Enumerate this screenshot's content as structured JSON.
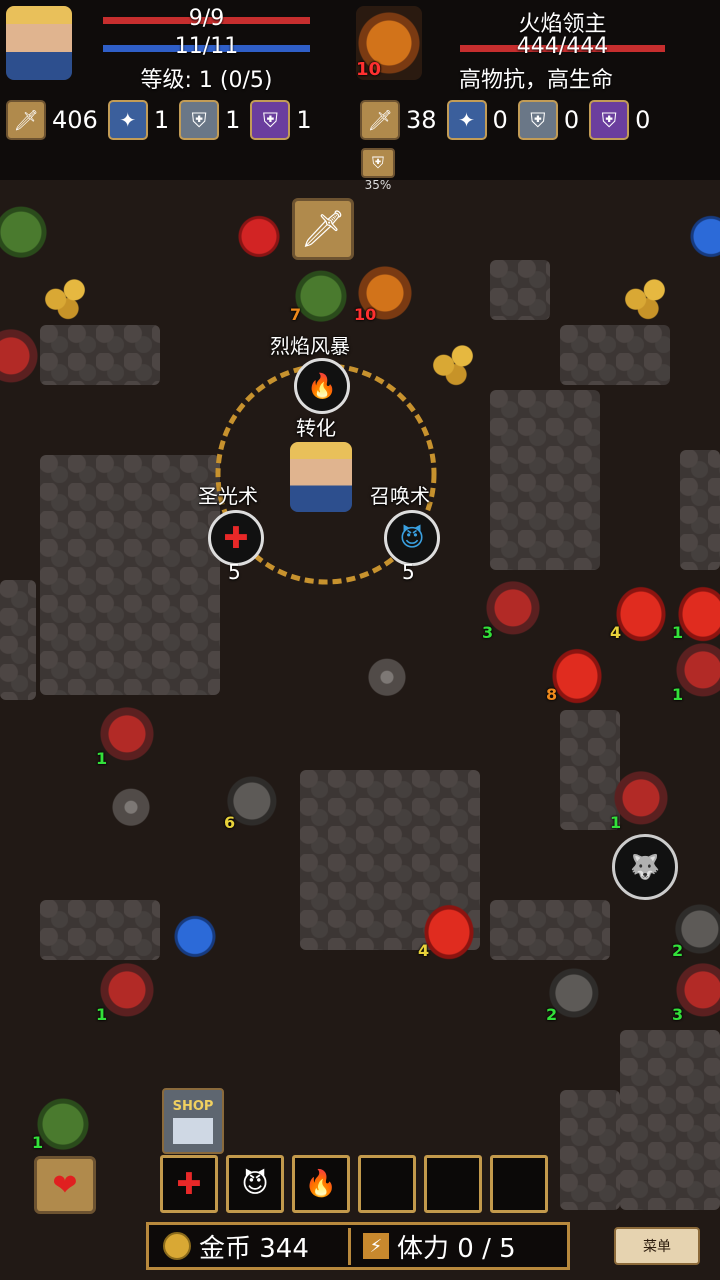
{
  "hero": {
    "hp": "9/9",
    "mp": "11/11",
    "level": "等级: 1 (0/5)",
    "stats": {
      "attack": "406",
      "magic": "1",
      "defense": "1",
      "magic_defense": "1"
    }
  },
  "target": {
    "name": "火焰领主",
    "hp": "444/444",
    "traits": "高物抗，高生命",
    "level": "10",
    "stats": {
      "attack": "38",
      "magic": "0",
      "defense": "0",
      "magic_defense": "0"
    },
    "defense_badge": "35%"
  },
  "skill_wheel": {
    "top": {
      "label": "烈焰风暴",
      "icon": "fire-icon"
    },
    "center": "转化",
    "left": {
      "label": "圣光术",
      "icon": "holy-cross-icon",
      "cost": "5"
    },
    "right": {
      "label": "召唤术",
      "icon": "summon-icon",
      "cost": "5"
    }
  },
  "map_levels": {
    "plant_top": "7",
    "firelord": "10",
    "demon_a": "3",
    "spider_a": "4",
    "spider_b": "1",
    "spider_c": "8",
    "demon_b": "1",
    "demon_c": "1",
    "wolf_a": "6",
    "demon_d": "1",
    "spider_d": "4",
    "wolf_b": "2",
    "demon_e": "1",
    "wolf_c": "2",
    "demon_f": "3",
    "plant_bottom": "1"
  },
  "shop_label": "SHOP",
  "resources": {
    "gold": "金币 344",
    "stamina": "体力 0 / 5"
  },
  "menu_label": "菜单",
  "hotbar": [
    "holy-cross-icon",
    "summon-icon",
    "fire-icon",
    "",
    "",
    ""
  ],
  "colors": {
    "hp": "#c62e2e",
    "mp": "#2f5fc8",
    "frame": "#c39a4c",
    "accent_gold": "#d9a834"
  }
}
